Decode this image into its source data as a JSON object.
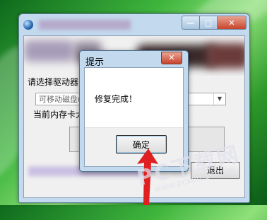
{
  "main_window": {
    "title_obscured": "",
    "caption_buttons": {
      "minimize": "—",
      "maximize": "□",
      "close": "✕"
    },
    "drive_group_label": "请选择驱动器",
    "drive_select_value": "可移动磁盘(",
    "memory_label": "当前内存卡大",
    "exit_label": "退出"
  },
  "dialog": {
    "title": "提示",
    "close": "✕",
    "message": "修复完成！",
    "ok_label": "确定"
  },
  "watermark": {
    "main": "PC下载网",
    "url": "www.pcsoft.com.cn"
  },
  "colors": {
    "desktop_green": "#3fb53d",
    "window_frame": "#c3d9ee",
    "close_red": "#c8442b",
    "annotation_red": "#e02020"
  },
  "icons": {
    "app": "app-globe-icon",
    "arrow": "red-annotation-arrow-icon"
  }
}
